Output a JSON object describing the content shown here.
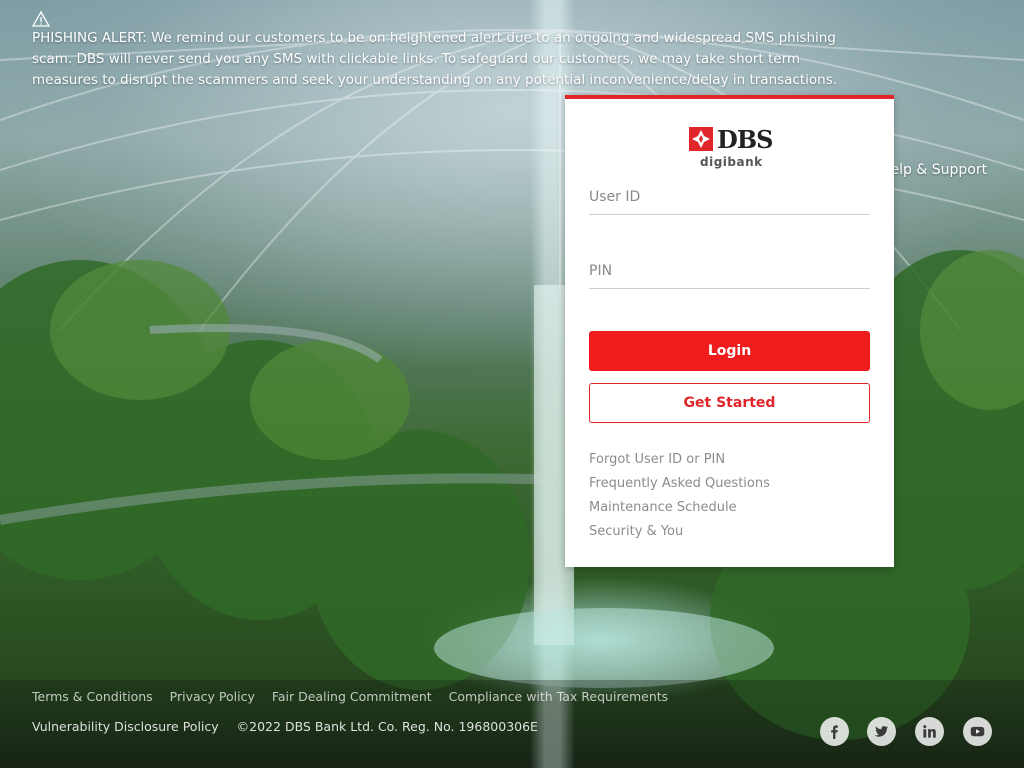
{
  "alert": {
    "icon": "warning-icon",
    "text": "PHISHING ALERT: We remind our customers to be on heightened alert due to an ongoing and widespread SMS phishing scam. DBS will never send you any SMS with clickable links. To safeguard our customers, we may take short term measures to disrupt the scammers and seek your understanding on any potential inconvenience/delay in transactions."
  },
  "header": {
    "help_label": "Help & Support"
  },
  "login": {
    "brand": "DBS",
    "brand_sub": "digibank",
    "accent_color": "#e0252b",
    "user_id_placeholder": "User ID",
    "pin_placeholder": "PIN",
    "login_label": "Login",
    "get_started_label": "Get Started",
    "links": [
      "Forgot User ID or PIN",
      "Frequently Asked Questions",
      "Maintenance Schedule",
      "Security & You"
    ]
  },
  "footer": {
    "links_row1": [
      "Terms & Conditions",
      "Privacy Policy",
      "Fair Dealing Commitment",
      "Compliance with Tax Requirements"
    ],
    "vdp_label": "Vulnerability Disclosure Policy",
    "copyright": "©2022 DBS Bank Ltd. Co. Reg. No. 196800306E",
    "social": [
      "facebook-icon",
      "twitter-icon",
      "linkedin-icon",
      "youtube-icon"
    ]
  }
}
